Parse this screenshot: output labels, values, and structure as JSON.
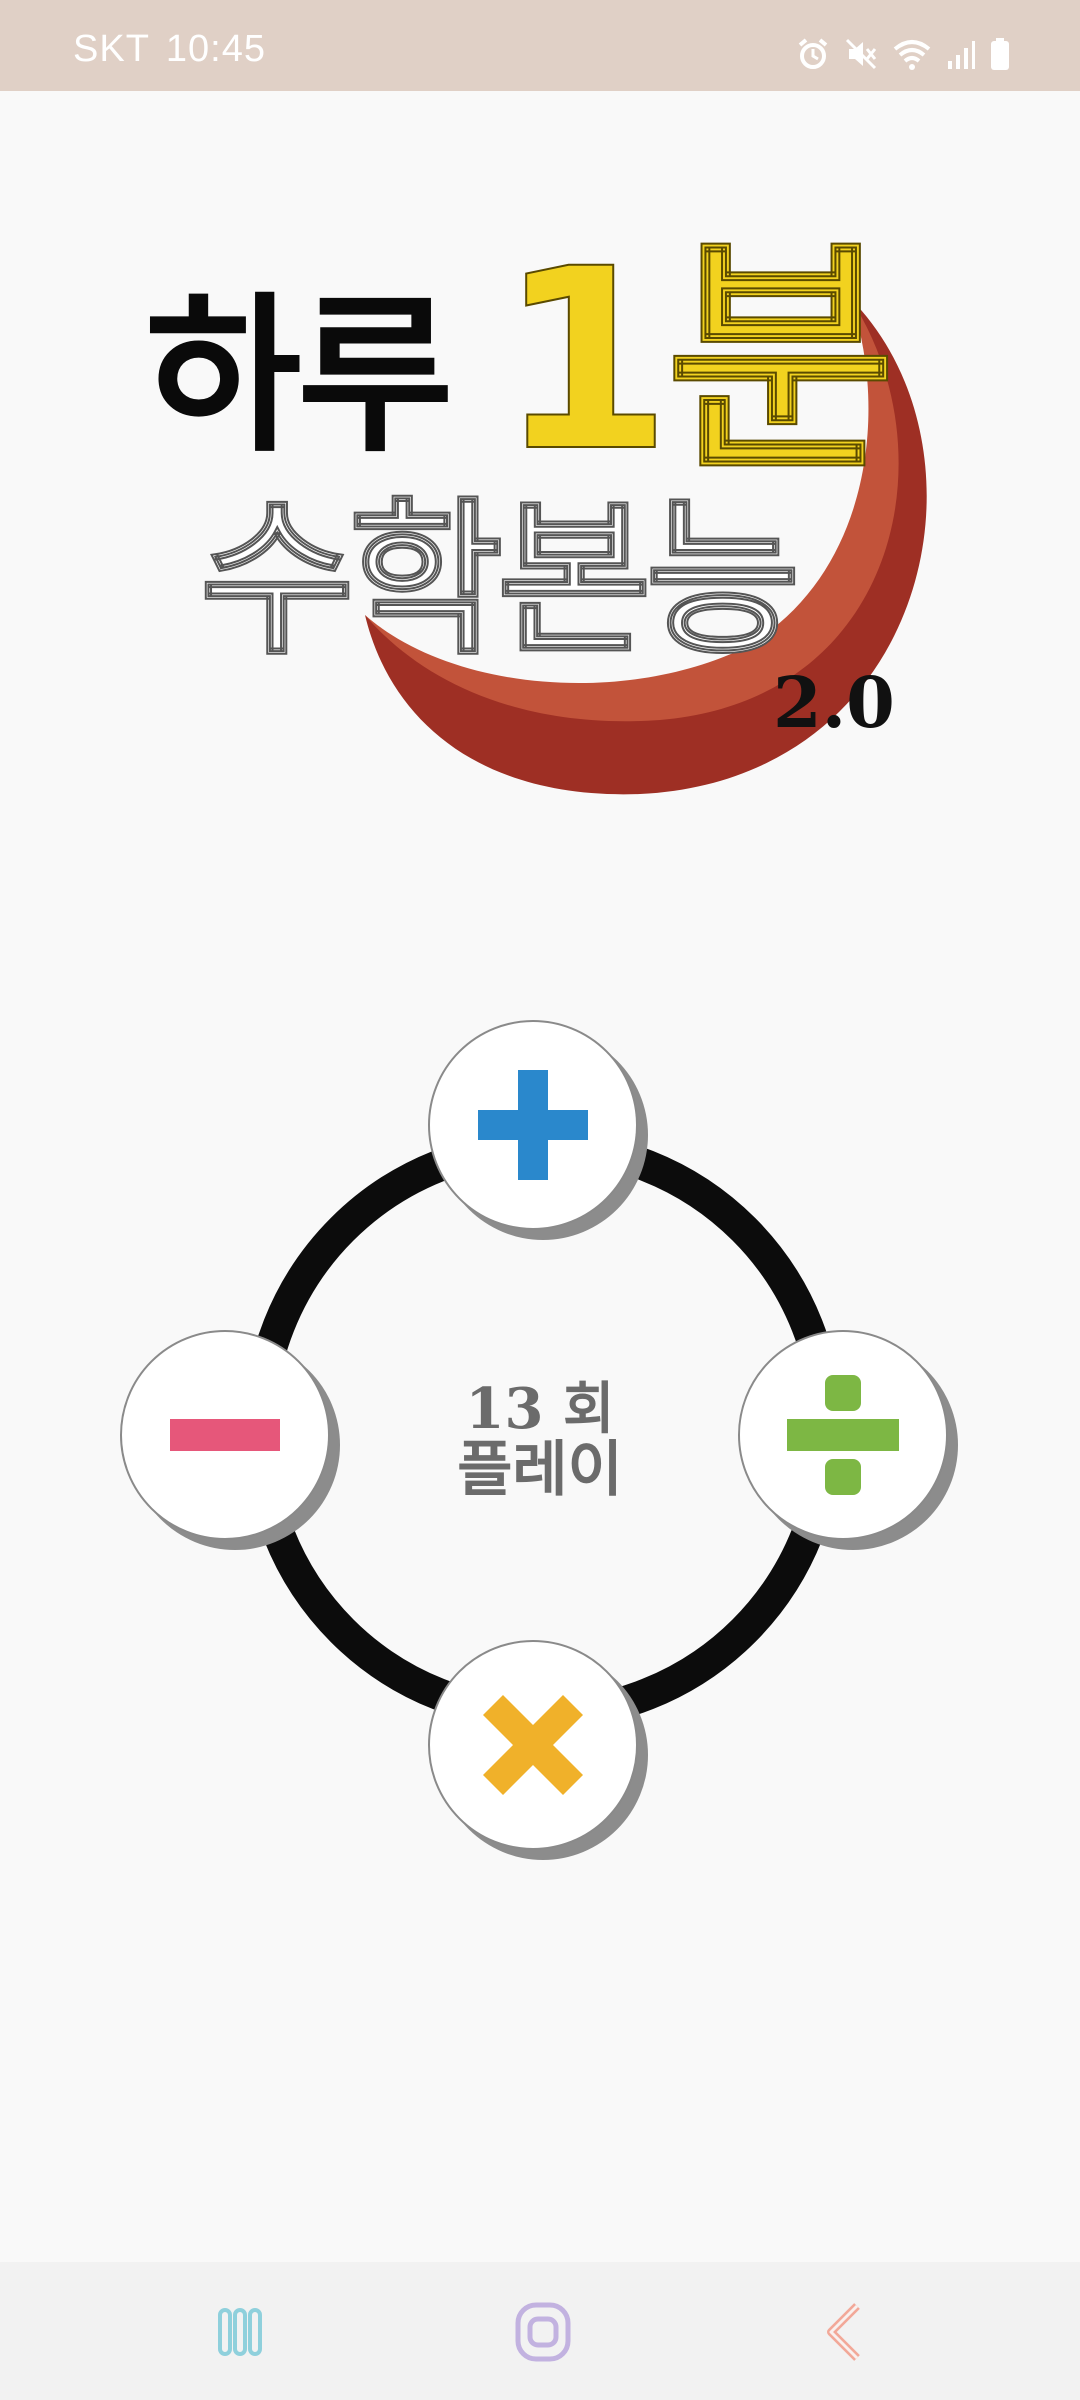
{
  "status_bar": {
    "carrier": "SKT",
    "time": "10:45",
    "icons": [
      "alarm-icon",
      "mute-icon",
      "wifi-icon",
      "signal-icon",
      "battery-icon"
    ]
  },
  "logo": {
    "line1_prefix": "하루",
    "line1_brand": "1분",
    "line2": "수학본능",
    "version": "2.0",
    "colors": {
      "brand_yellow": "#f2d21f",
      "crescent": "#c2533a",
      "crescent_dark": "#9e2f24"
    }
  },
  "operations": [
    {
      "name": "plus",
      "icon": "plus-icon",
      "color": "#2a88cc"
    },
    {
      "name": "minus",
      "icon": "minus-icon",
      "color": "#e6577a"
    },
    {
      "name": "divide",
      "icon": "divide-icon",
      "color": "#7db744"
    },
    {
      "name": "multiply",
      "icon": "multiply-icon",
      "color": "#f0b12a"
    }
  ],
  "play_count": {
    "count": "13 회",
    "label": "플레이"
  },
  "nav_bar": {
    "icons": [
      "recent-apps-icon",
      "home-icon",
      "back-icon"
    ]
  }
}
